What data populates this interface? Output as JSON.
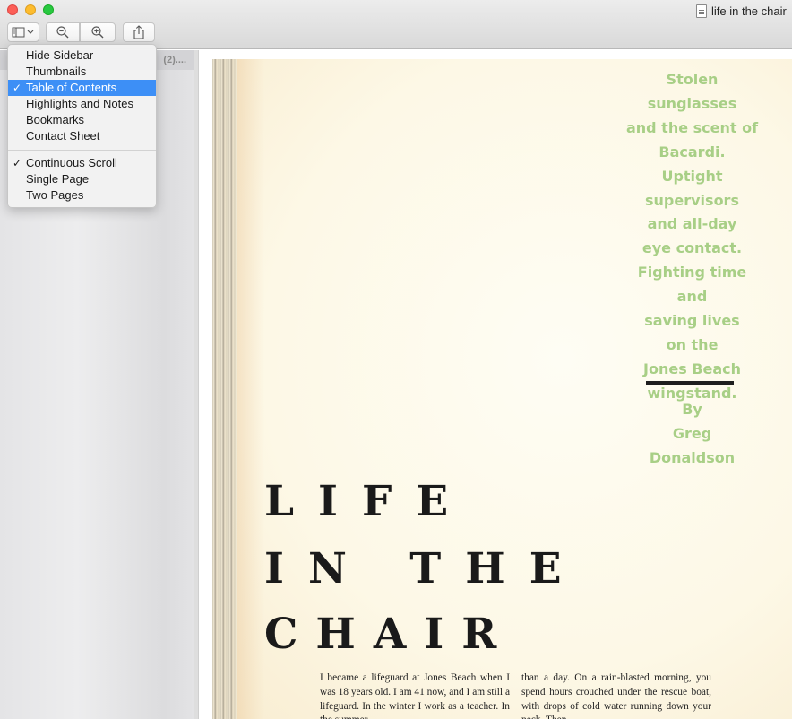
{
  "window": {
    "title": "life in the chair"
  },
  "toolbar": {
    "sidebar_button_icon": "sidebar-icon",
    "zoom_out_icon": "zoom-out-icon",
    "zoom_in_icon": "zoom-in-icon",
    "share_icon": "share-icon"
  },
  "sidebar": {
    "header_text": "(2)...."
  },
  "menu": {
    "view_items": [
      {
        "label": "Hide Sidebar",
        "checked": false
      },
      {
        "label": "Thumbnails",
        "checked": false
      },
      {
        "label": "Table of Contents",
        "checked": true
      },
      {
        "label": "Highlights and Notes",
        "checked": false
      },
      {
        "label": "Bookmarks",
        "checked": false
      },
      {
        "label": "Contact Sheet",
        "checked": false
      }
    ],
    "display_items": [
      {
        "label": "Continuous Scroll",
        "checked": true
      },
      {
        "label": "Single Page",
        "checked": false
      },
      {
        "label": "Two Pages",
        "checked": false
      }
    ],
    "check_glyph": "✓"
  },
  "page": {
    "deck_lines": [
      "Stolen",
      "sunglasses",
      "and the scent of",
      "Bacardi.",
      "Uptight supervisors",
      "and all-day",
      "eye contact.",
      "Fighting time",
      "and",
      "saving lives",
      "on the",
      "Jones Beach",
      "wingstand."
    ],
    "byline_lines": [
      "By",
      "Greg",
      "Donaldson"
    ],
    "headline_lines": [
      "LIFE",
      "IN THE",
      "CHAIR"
    ],
    "column1": "I became a lifeguard at Jones Beach when I was 18 years old. I am 41 now, and I am still a lifeguard. In the winter I work as a teacher. In the summer",
    "column2": "than a day. On a rain-blasted morning, you spend hours crouched under the rescue boat, with drops of cold water running down your neck. Then"
  },
  "colors": {
    "deck_green": "#a8cf86",
    "menu_highlight": "#3d8ff6"
  }
}
